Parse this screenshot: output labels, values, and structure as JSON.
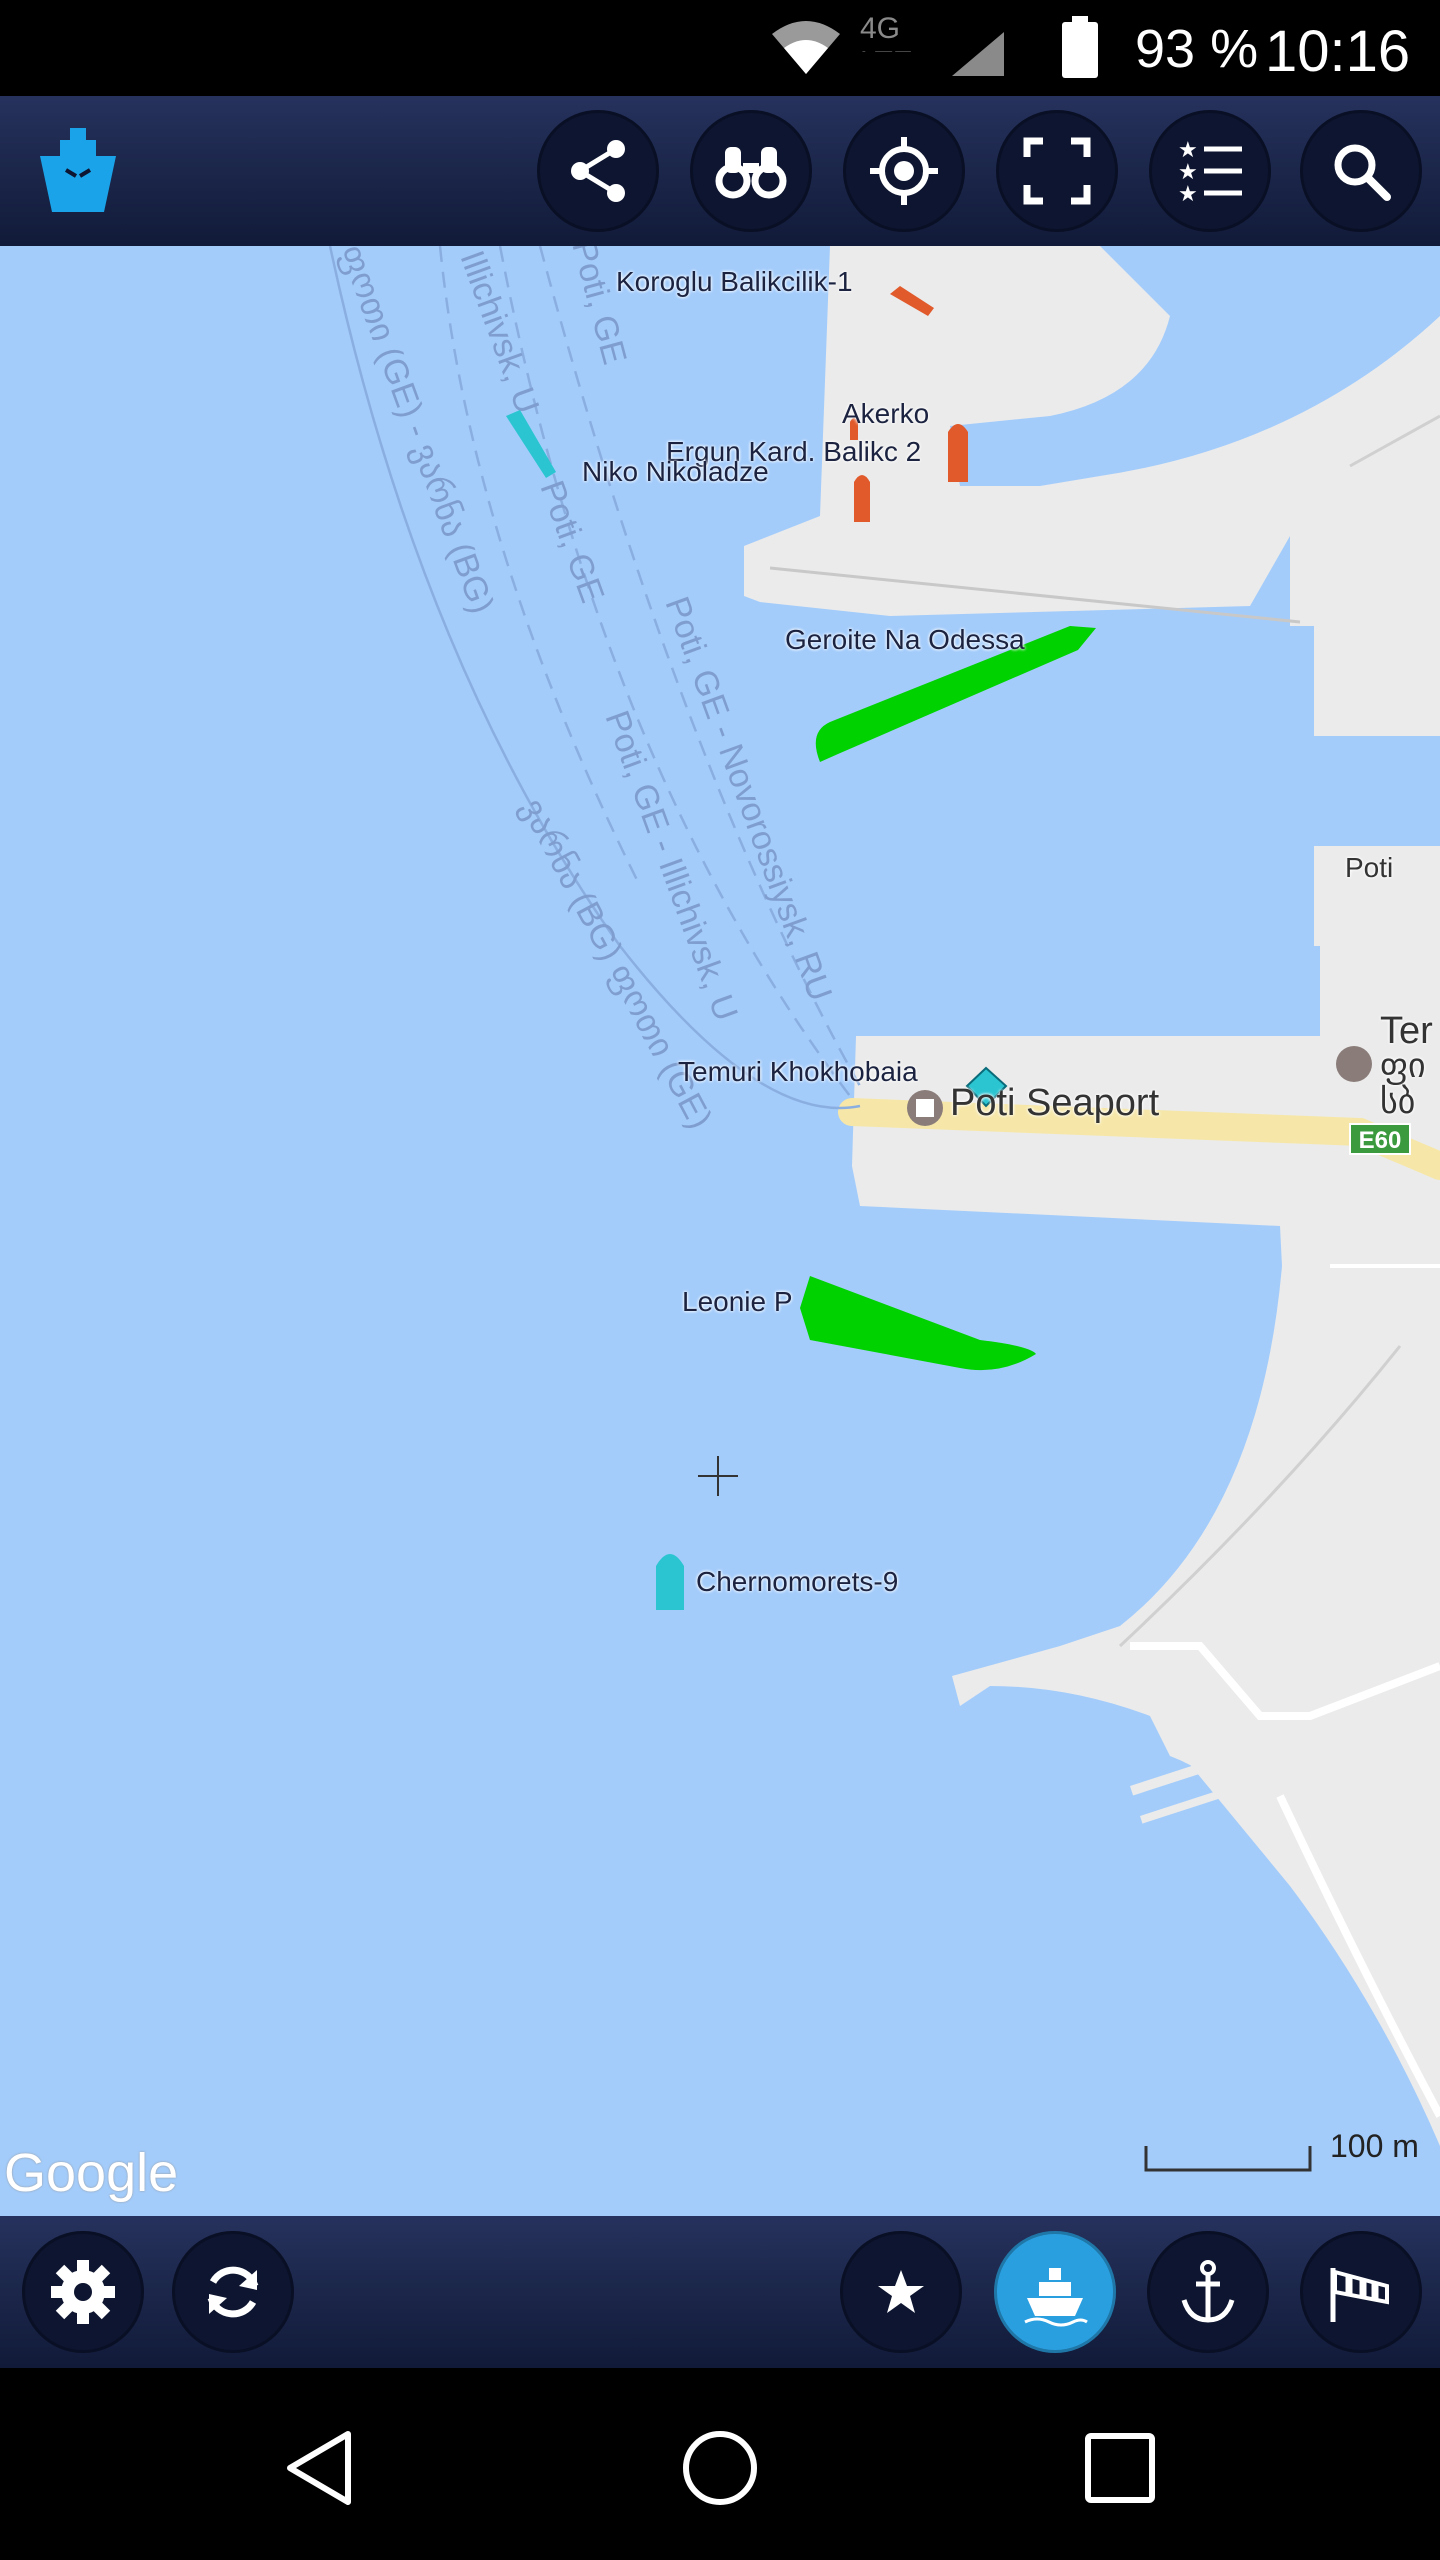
{
  "status_bar": {
    "battery": "93 %",
    "time": "10:16",
    "network": "4G LTE"
  },
  "toolbar": {
    "app_icon": "ship-logo-icon",
    "buttons": [
      "share-icon",
      "binoculars-icon",
      "locate-icon",
      "fullscreen-icon",
      "starred-list-icon",
      "search-icon"
    ]
  },
  "map": {
    "vessels": [
      {
        "name": "Koroglu Balikcilik-1",
        "color": "#e15a2b"
      },
      {
        "name": "Akerko",
        "color": "#e15a2b"
      },
      {
        "name": "Ergun Kard. Balikc 2",
        "color": "#e15a2b"
      },
      {
        "name": "Niko Nikoladze",
        "color": "#2bc5d1"
      },
      {
        "name": "Geroite Na Odessa",
        "color": "#00d200"
      },
      {
        "name": "Temuri Khokhobaia",
        "color": "#2bc5d1"
      },
      {
        "name": "Leonie P",
        "color": "#00d200"
      },
      {
        "name": "Chernomorets-9",
        "color": "#2bc5d1"
      }
    ],
    "route_labels": [
      "Poti, GE - Novorossiysk, RU",
      "Poti, GE - Illichivsk, U",
      "Illichivsk, U",
      "Poti, GE",
      "ფოთი (GE) - ვარნა (BG)",
      "ვარნა (BG) ფოთი (GE)"
    ],
    "place_labels": {
      "poti": "Poti",
      "seaport": "Poti Seaport",
      "ter": "Ter",
      "geo1": "ფი",
      "geo2": "სბ",
      "road": "E60"
    },
    "scale": "100 m",
    "attribution": "Google"
  },
  "bottom_bar": {
    "buttons": [
      "settings-icon",
      "refresh-icon",
      "favorites-icon",
      "vessels-icon",
      "anchor-icon",
      "wind-icon"
    ],
    "active": "vessels-icon",
    "active_color": "#2a9fe0"
  },
  "nav_bar": [
    "back-icon",
    "home-icon",
    "recents-icon"
  ]
}
